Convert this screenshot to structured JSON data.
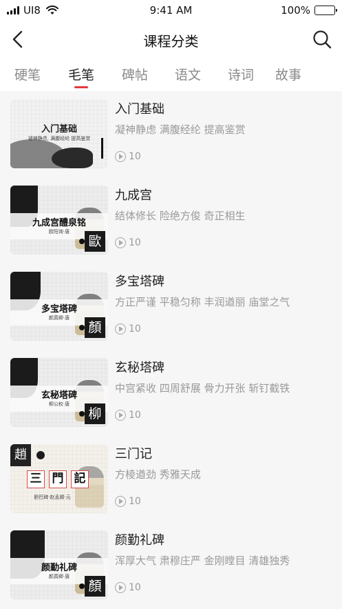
{
  "status_bar": {
    "carrier": "UI8",
    "time": "9:41 AM",
    "battery": "100%",
    "battery_level": 1.0
  },
  "nav": {
    "title": "课程分类",
    "back_icon": "chevron-left-icon",
    "search_icon": "search-icon"
  },
  "tabs": [
    {
      "label": "硬笔",
      "active": false
    },
    {
      "label": "毛笔",
      "active": true
    },
    {
      "label": "碑帖",
      "active": false
    },
    {
      "label": "语文",
      "active": false
    },
    {
      "label": "诗词",
      "active": false
    },
    {
      "label": "故事",
      "active": false
    }
  ],
  "accent_color": "#e8383d",
  "courses": [
    {
      "title": "入门基础",
      "description": "凝神静虑 满腹经纶 提高鉴赏",
      "count": "10",
      "thumb": {
        "title": "入门基础",
        "subtitle": "凝神静虑, 满腹经纶  提高鉴赏",
        "seal": ""
      }
    },
    {
      "title": "九成宫",
      "description": "结体修长 险绝方俊 奇正相生",
      "count": "10",
      "thumb": {
        "title": "九成宫醴泉铭",
        "subtitle": "欧阳询·唐",
        "seal": "歐"
      }
    },
    {
      "title": "多宝塔碑",
      "description": "方正严谨 平稳匀称 丰润遒丽 庙堂之气",
      "count": "10",
      "thumb": {
        "title": "多宝塔碑",
        "subtitle": "颜真卿·唐",
        "seal": "顏"
      }
    },
    {
      "title": "玄秘塔碑",
      "description": "中宫紧收 四周舒展 骨力开张 斩钉截铁",
      "count": "10",
      "thumb": {
        "title": "玄秘塔碑",
        "subtitle": "柳公权·唐",
        "seal": "柳"
      }
    },
    {
      "title": "三门记",
      "description": "方棱遒劲 秀雅天成",
      "count": "10",
      "thumb": {
        "chars": [
          "三",
          "門",
          "記"
        ],
        "subtitle": "胆巴碑·赵孟頫·元",
        "corner": "趙"
      }
    },
    {
      "title": "颜勤礼碑",
      "description": "浑厚大气 肃穆庄严 金刚瞠目 清雄独秀",
      "count": "10",
      "thumb": {
        "title": "颜勤礼碑",
        "subtitle": "颜真卿·唐",
        "seal": "顏"
      }
    }
  ]
}
